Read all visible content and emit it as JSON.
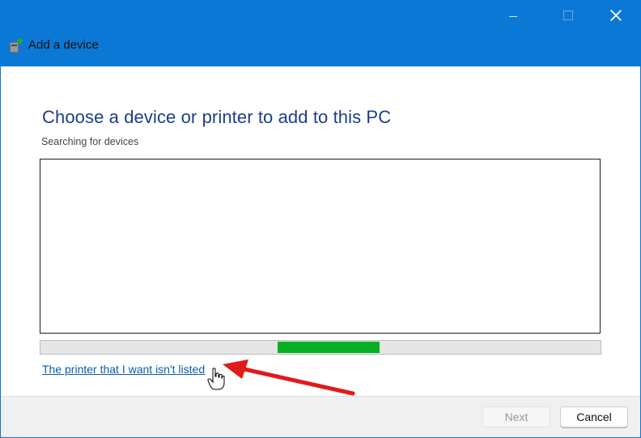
{
  "window": {
    "title": "Add a device",
    "controls": [
      "minimize",
      "maximize",
      "close"
    ]
  },
  "main": {
    "heading": "Choose a device or printer to add to this PC",
    "status_text": "Searching for devices",
    "device_list": [],
    "progress": {
      "indeterminate": true,
      "fill_color": "#06b025"
    },
    "link_text": "The printer that I want isn't listed"
  },
  "footer": {
    "next_label": "Next",
    "cancel_label": "Cancel"
  },
  "colors": {
    "titlebar": "#0a78d4",
    "heading": "#1c3d8c",
    "link": "#0b5cad",
    "annotation_arrow": "#e11a1a"
  },
  "icons": {
    "app": "device-add-icon",
    "cursor": "hand-pointer-icon"
  }
}
